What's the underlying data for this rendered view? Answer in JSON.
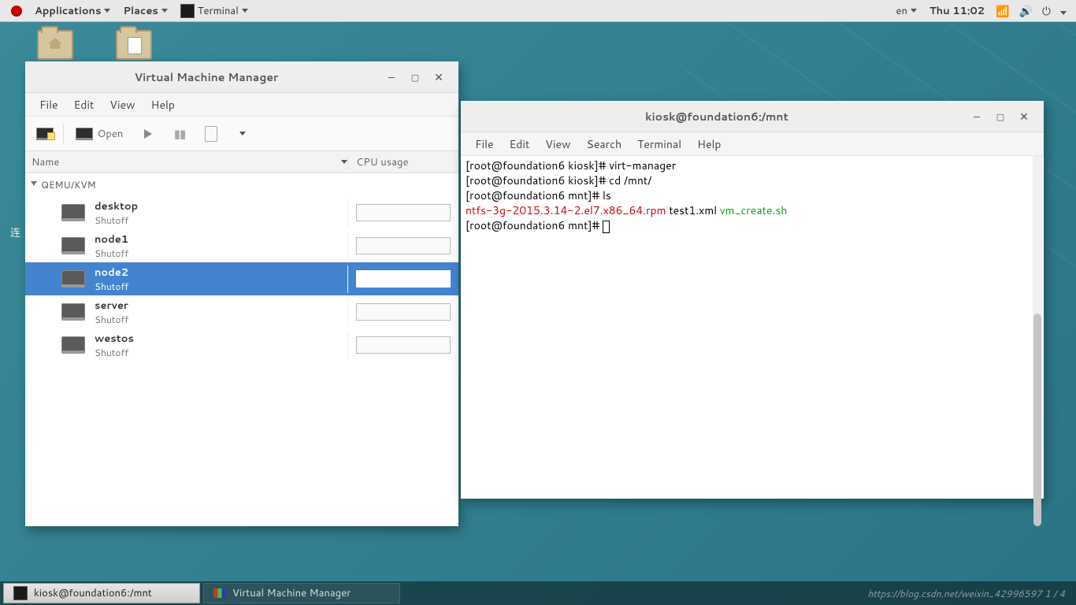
{
  "top_panel": {
    "applications": "Applications",
    "places": "Places",
    "running_app": "Terminal",
    "lang": "en",
    "clock": "Thu 11:02"
  },
  "desktop": {
    "icon1_label": "",
    "icon2_label": "",
    "partial_text": "连"
  },
  "vmm": {
    "title": "Virtual Machine Manager",
    "menu": {
      "file": "File",
      "edit": "Edit",
      "view": "View",
      "help": "Help"
    },
    "toolbar": {
      "open_label": "Open"
    },
    "columns": {
      "name": "Name",
      "cpu": "CPU usage"
    },
    "hypervisor": "QEMU/KVM",
    "vms": [
      {
        "name": "desktop",
        "state": "Shutoff",
        "selected": false
      },
      {
        "name": "node1",
        "state": "Shutoff",
        "selected": false
      },
      {
        "name": "node2",
        "state": "Shutoff",
        "selected": true
      },
      {
        "name": "server",
        "state": "Shutoff",
        "selected": false
      },
      {
        "name": "westos",
        "state": "Shutoff",
        "selected": false
      }
    ]
  },
  "terminal": {
    "title": "kiosk@foundation6:/mnt",
    "menu": {
      "file": "File",
      "edit": "Edit",
      "view": "View",
      "search": "Search",
      "terminal": "Terminal",
      "help": "Help"
    },
    "lines": {
      "p1": "[root@foundation6 kiosk]# ",
      "c1": "virt-manager",
      "p2": "[root@foundation6 kiosk]# ",
      "c2": "cd /mnt/",
      "p3": "[root@foundation6 mnt]# ",
      "c3": "ls",
      "ls_red": "ntfs-3g-2015.3.14-2.el7.x86_64.rpm",
      "ls_plain": "  test1.xml   ",
      "ls_green": "vm_create.sh",
      "p4": "[root@foundation6 mnt]# "
    }
  },
  "taskbar": {
    "task1": "kiosk@foundation6:/mnt",
    "task2": "Virtual Machine Manager",
    "watermark": "https://blog.csdn.net/weixin_42996597  1 / 4"
  }
}
